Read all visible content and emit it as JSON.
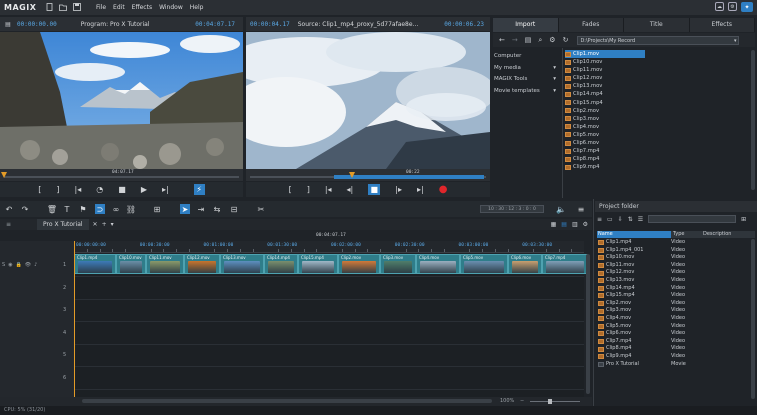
{
  "app": {
    "logo": "MAGIX"
  },
  "menu": {
    "items": [
      "File",
      "Edit",
      "Effects",
      "Window",
      "Help"
    ]
  },
  "program_monitor": {
    "tc_left": "00:00:00.00",
    "title": "Program: Pro X Tutorial",
    "tc_right": "00:04:07.17",
    "scrub_time": "04:07.17"
  },
  "source_monitor": {
    "tc_left": "00:00:04.17",
    "title": "Source: Clip1_mp4_proxy_5d77afae8e...",
    "tc_right": "00:00:06.23",
    "scrub_time": "00:22"
  },
  "import_tabs": [
    "Import",
    "Fades",
    "Title",
    "Effects"
  ],
  "import_path": "D:\\Projects\\My Record",
  "import_tree": [
    {
      "label": "Computer",
      "arrow": ""
    },
    {
      "label": "My media",
      "arrow": "▾"
    },
    {
      "label": "MAGIX Tools",
      "arrow": "▾"
    },
    {
      "label": "Movie templates",
      "arrow": "▾"
    }
  ],
  "import_files": [
    "Clip1.mov",
    "Clip10.mov",
    "Clip11.mov",
    "Clip12.mov",
    "Clip13.mov",
    "Clip14.mp4",
    "Clip15.mp4",
    "Clip2.mov",
    "Clip3.mov",
    "Clip4.mov",
    "Clip5.mov",
    "Clip6.mov",
    "Clip7.mp4",
    "Clip8.mp4",
    "Clip9.mp4"
  ],
  "timeline": {
    "project_tab": "Pro X Tutorial",
    "playhead_tc": "00:04:07.17",
    "timecode_field": "10 : 30 : 12 : 3 : 0 : 0",
    "ruler_labels": [
      "00:00:00:00",
      "00:00:30:00",
      "00:01:00:00",
      "00:01:30:00",
      "00:02:00:00",
      "00:02:30:00",
      "00:03:00:00",
      "00:03:30:00"
    ],
    "track_numbers": [
      "1",
      "2",
      "3",
      "4",
      "5",
      "6"
    ],
    "zoom": "100%",
    "clip_titles": [
      "Clip1.mp4",
      "Clip10.mov",
      "Clip11.mov",
      "Clip12.mov",
      "Clip13.mov",
      "Clip14.mp4",
      "Clip15.mp4",
      "Clip2.mov",
      "Clip3.mov",
      "Clip4.mov",
      "Clip5.mov",
      "Clip6.mov",
      "Clip7.mp4"
    ]
  },
  "project_folder": {
    "title": "Project folder",
    "columns": [
      "Name",
      "Type",
      "Description"
    ],
    "rows": [
      {
        "name": "Clip1.mp4",
        "type": "Video"
      },
      {
        "name": "Clip1.mp4_001",
        "type": "Video"
      },
      {
        "name": "Clip10.mov",
        "type": "Video"
      },
      {
        "name": "Clip11.mov",
        "type": "Video"
      },
      {
        "name": "Clip12.mov",
        "type": "Video"
      },
      {
        "name": "Clip13.mov",
        "type": "Video"
      },
      {
        "name": "Clip14.mp4",
        "type": "Video"
      },
      {
        "name": "Clip15.mp4",
        "type": "Video"
      },
      {
        "name": "Clip2.mov",
        "type": "Video"
      },
      {
        "name": "Clip3.mov",
        "type": "Video"
      },
      {
        "name": "Clip4.mov",
        "type": "Video"
      },
      {
        "name": "Clip5.mov",
        "type": "Video"
      },
      {
        "name": "Clip6.mov",
        "type": "Video"
      },
      {
        "name": "Clip7.mp4",
        "type": "Video"
      },
      {
        "name": "Clip8.mp4",
        "type": "Video"
      },
      {
        "name": "Clip9.mp4",
        "type": "Video"
      },
      {
        "name": "Pro X Tutorial",
        "type": "Movie"
      }
    ]
  },
  "status": {
    "text": "CPU: 5% (31/20)"
  },
  "colors": {
    "accent": "#2f7fc3",
    "clip": "#2f7d8a",
    "timecode": "#5aa9e6",
    "record": "#e0262b"
  }
}
